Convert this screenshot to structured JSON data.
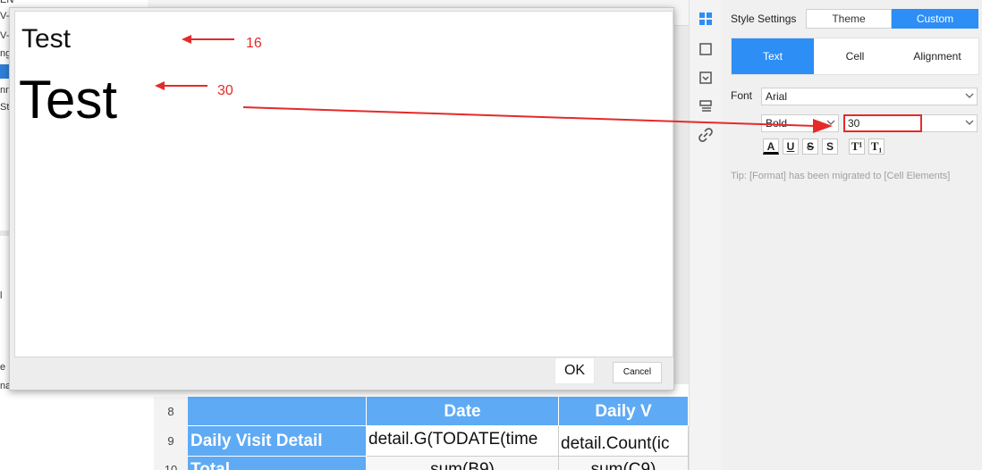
{
  "sheet": {
    "rows": [
      {
        "num": "8",
        "cells": [
          "",
          "Date",
          "Daily V"
        ]
      },
      {
        "num": "9",
        "cells": [
          "Daily Visit Detail",
          "detail.G(TODATE(time",
          "detail.Count(ic"
        ]
      },
      {
        "num": "10",
        "cells": [
          "Total",
          "sum(B9)",
          "sum(C9)"
        ]
      }
    ]
  },
  "style_panel": {
    "title": "Style Settings",
    "theme_label": "Theme",
    "custom_label": "Custom",
    "tabs": [
      {
        "label": "Text",
        "active": true
      },
      {
        "label": "Cell",
        "active": false
      },
      {
        "label": "Alignment",
        "active": false
      }
    ],
    "font_label": "Font",
    "font_value": "Arial",
    "weight_value": "Bold",
    "size_value": "30",
    "format_buttons": [
      "A",
      "U",
      "S",
      "S",
      "T¹",
      "T₁"
    ],
    "tip": "Tip: [Format] has been migrated to [Cell Elements]"
  },
  "dialog": {
    "preview_small": "Test",
    "preview_large": "Test",
    "ok_label": "OK",
    "cancel_label": "Cancel"
  },
  "annotations": {
    "small_size": "16",
    "large_size": "30"
  },
  "colors": {
    "accent": "#2d8ef5",
    "header_cell": "#5eaaf5",
    "annotation": "#e52a2a"
  }
}
